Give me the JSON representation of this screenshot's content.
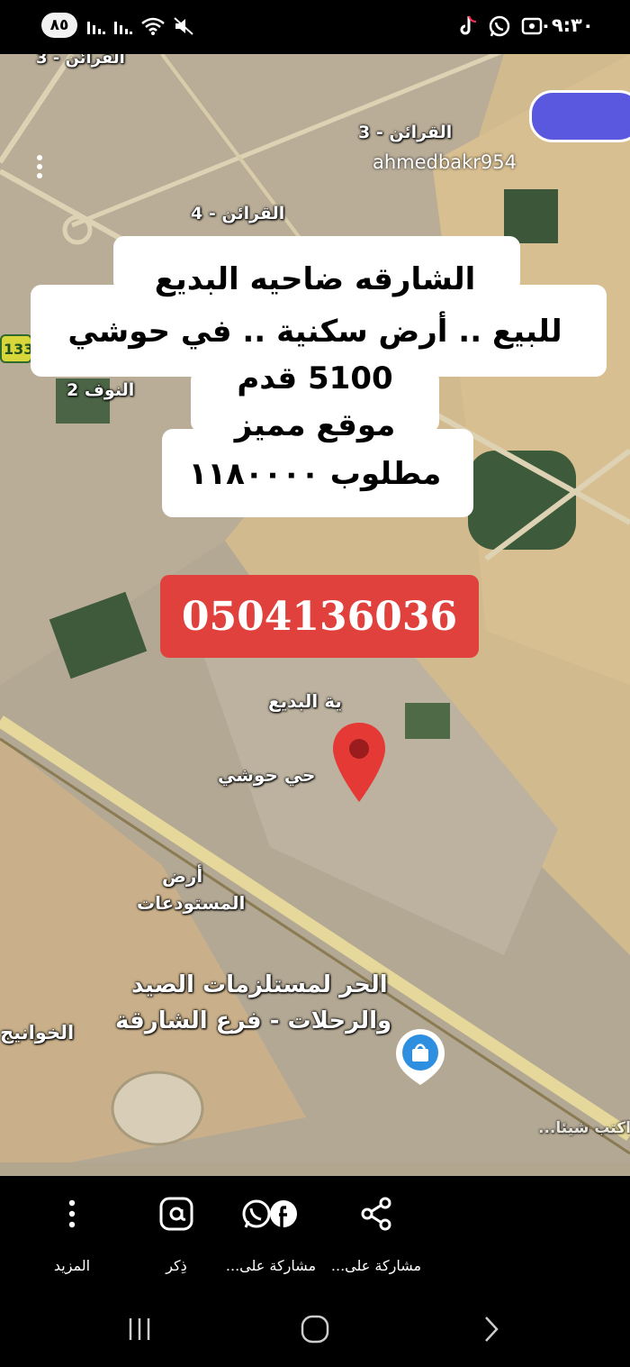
{
  "status_bar": {
    "battery": "٨٥",
    "time": "٠٩:٣٠",
    "icons": [
      "signal-icon",
      "signal-icon",
      "wifi-icon",
      "mute-icon",
      "tiktok-icon",
      "whatsapp-icon",
      "screenshot-icon"
    ]
  },
  "post": {
    "watermark": "ahmedbakr954",
    "headline": {
      "line1": "الشارقه ضاحيه البديع",
      "line2": "للبيع .. أرض سكنية .. في حوشي",
      "line3": "5100 قدم",
      "line4": "موقع مميز",
      "line5": "مطلوب ١١٨٠٠٠٠"
    },
    "phone": "0504136036"
  },
  "map": {
    "labels": {
      "qarain3": "القرائن - 3",
      "qarain3_top": "القرائن - 3",
      "qarain4": "القرائن - 4",
      "nouf2": "النوف 2",
      "badie": "ية البديع",
      "hoshi": "حي حوشي",
      "ard": "أرض",
      "warehouses": "المستودعات",
      "shop_line1": "الحر لمستلزمات الصيد",
      "shop_line2": "والرحلات - فرع الشارقة",
      "khawaneej": "الخوانيج",
      "write_something": "اكتب شيئا...",
      "road_tag": "133"
    },
    "colors": {
      "desert": "#d2ba8f",
      "urban": "#b8ab96",
      "vegetation": "#3d5a3a",
      "road": "#e8dcae",
      "pin": "#e53935"
    }
  },
  "action_bar": {
    "items": [
      {
        "label": "المزيد",
        "icon": "more-vertical-icon"
      },
      {
        "label": "ذِكر",
        "icon": "mention-icon"
      },
      {
        "label": "مشاركة على...",
        "icon": "whatsapp-facebook-icon"
      },
      {
        "label": "مشاركة على...",
        "icon": "share-icon"
      }
    ]
  },
  "nav_bar": {
    "buttons": [
      "recent-apps-icon",
      "home-icon",
      "back-icon"
    ]
  }
}
